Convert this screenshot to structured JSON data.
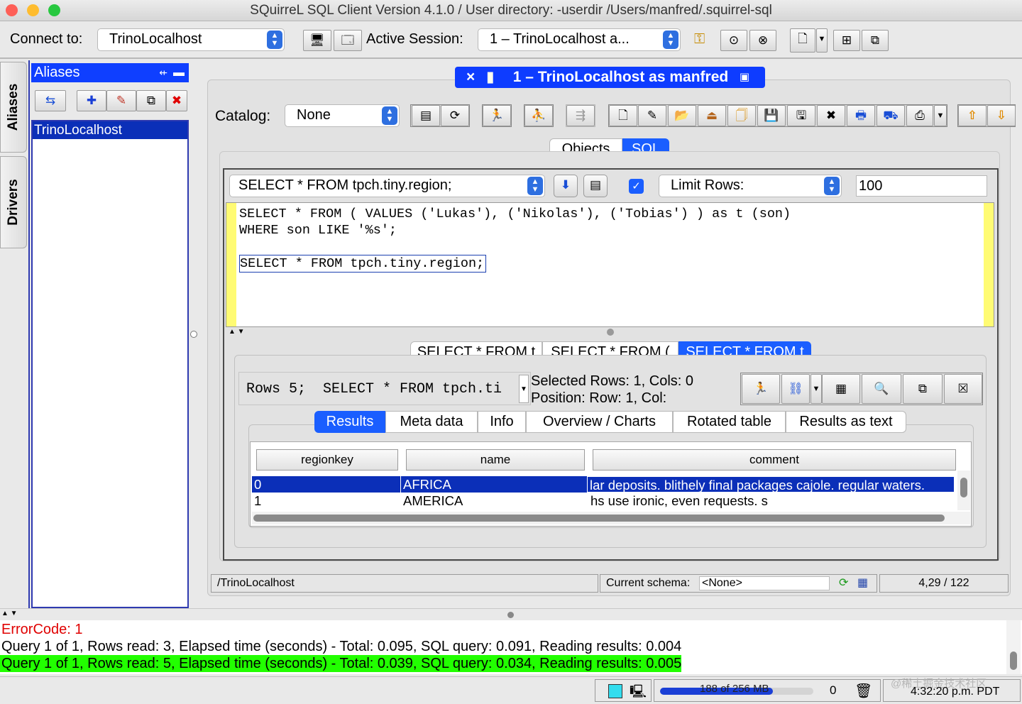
{
  "window": {
    "title": "SQuirreL SQL Client Version 4.1.0 / User directory: -userdir /Users/manfred/.squirrel-sql"
  },
  "toolbar": {
    "connect_label": "Connect to:",
    "connect_value": "TrinoLocalhost",
    "active_session_label": "Active Session:",
    "active_session_value": "1 – TrinoLocalhost  a..."
  },
  "side_tabs": {
    "aliases": "Aliases",
    "drivers": "Drivers"
  },
  "aliases": {
    "header": "Aliases",
    "items": [
      "TrinoLocalhost"
    ]
  },
  "session": {
    "tab_title": "1 – TrinoLocalhost  as manfred",
    "catalog_label": "Catalog:",
    "catalog_value": "None",
    "view_tabs": [
      "Objects",
      "SQL"
    ],
    "history_value": "SELECT * FROM tpch.tiny.region;",
    "limit_rows_checked": true,
    "limit_rows_label": "Limit Rows:",
    "limit_rows_value": "100"
  },
  "editor": {
    "lines": [
      "SELECT * FROM ( VALUES ('Lukas'), ('Nikolas'), ('Tobias') ) as t (son)",
      "WHERE son LIKE '%s';",
      "",
      "SELECT * FROM tpch.tiny.region;"
    ]
  },
  "result_tabs": [
    "SELECT * FROM t",
    "SELECT * FROM (",
    "SELECT * FROM t"
  ],
  "result_info": {
    "rows_query": "Rows 5;  SELECT * FROM tpch.ti",
    "selected": "Selected Rows: 1, Cols: 0",
    "position": "Position: Row: 1, Col:"
  },
  "result_sub_tabs": [
    "Results",
    "Meta data",
    "Info",
    "Overview / Charts",
    "Rotated table",
    "Results as text"
  ],
  "table": {
    "columns": [
      "regionkey",
      "name",
      "comment"
    ],
    "rows": [
      [
        "0",
        "AFRICA",
        "lar deposits. blithely final packages cajole. regular waters."
      ],
      [
        "1",
        "AMERICA",
        "hs use ironic, even requests. s"
      ]
    ]
  },
  "status": {
    "alias_path": "/TrinoLocalhost",
    "schema_label": "Current schema:",
    "schema_value": "<None>",
    "caret": "4,29 / 122"
  },
  "log": {
    "error": "ErrorCode: 1",
    "line1": "Query 1 of 1, Rows read: 3, Elapsed time (seconds) - Total: 0.095, SQL query: 0.091, Reading results: 0.004",
    "line2": "Query 1 of 1, Rows read: 5, Elapsed time (seconds) - Total: 0.039, SQL query: 0.034, Reading results: 0.005"
  },
  "bottom": {
    "memory": "188 of 256 MB",
    "memory_fraction": 0.734,
    "counter": "0",
    "clock": "4:32:20 p.m. PDT",
    "watermark": "@稀土掘金技术社区"
  },
  "colors": {
    "selection_blue": "#0b2fb8",
    "accent_blue": "#1a5eff",
    "editor_margin_yellow": "#fffb73",
    "log_success_green": "#22ff00",
    "error_red": "#e00000"
  }
}
